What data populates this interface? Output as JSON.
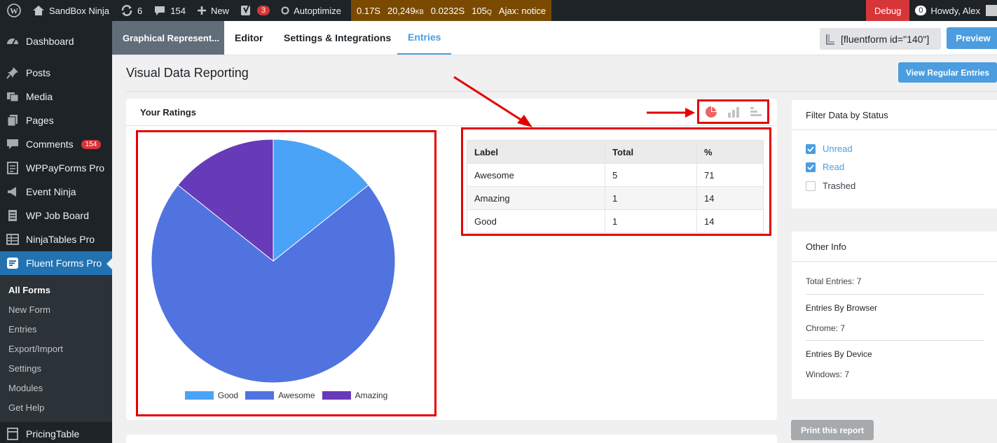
{
  "adminbar": {
    "site_name": "SandBox Ninja",
    "updates_count": "6",
    "comments_count": "154",
    "new_label": "New",
    "yoast_count": "3",
    "autoptimize_label": "Autoptimize",
    "perf_time": "0.17S",
    "perf_memory": "20,249",
    "perf_memory_unit": "KB",
    "perf_query_time": "0.0232S",
    "perf_queries": "105",
    "perf_queries_unit": "Q",
    "perf_ajax": "Ajax: notice",
    "debug_label": "Debug",
    "notif_count": "0",
    "howdy": "Howdy, Alex"
  },
  "sidebar": {
    "items": [
      {
        "label": "Dashboard"
      },
      {
        "label": "Posts"
      },
      {
        "label": "Media"
      },
      {
        "label": "Pages"
      },
      {
        "label": "Comments",
        "badge": "154"
      },
      {
        "label": "WPPayForms Pro"
      },
      {
        "label": "Event Ninja"
      },
      {
        "label": "WP Job Board"
      },
      {
        "label": "NinjaTables Pro"
      },
      {
        "label": "Fluent Forms Pro"
      },
      {
        "label": "PricingTable"
      }
    ],
    "submenu": [
      "All Forms",
      "New Form",
      "Entries",
      "Export/Import",
      "Settings",
      "Modules",
      "Get Help"
    ]
  },
  "topnav": {
    "form_title": "Graphical Represent...",
    "tabs": [
      "Editor",
      "Settings & Integrations",
      "Entries"
    ],
    "shortcode": "[fluentform id=\"140\"]",
    "preview_label": "Preview"
  },
  "page": {
    "title": "Visual Data Reporting",
    "view_regular_label": "View Regular Entries",
    "print_label": "Print this report"
  },
  "report": {
    "card_title": "Your Ratings",
    "table_headers": [
      "Label",
      "Total",
      "%"
    ],
    "rows": [
      [
        "Awesome",
        "5",
        "71"
      ],
      [
        "Amazing",
        "1",
        "14"
      ],
      [
        "Good",
        "1",
        "14"
      ]
    ]
  },
  "chart_data": {
    "type": "pie",
    "categories": [
      "Good",
      "Awesome",
      "Amazing"
    ],
    "values": [
      1,
      5,
      1
    ],
    "colors": [
      "#4aa3f7",
      "#5173e0",
      "#673ab7"
    ],
    "legend": "bottom"
  },
  "filter": {
    "title": "Filter Data by Status",
    "options": [
      {
        "label": "Unread",
        "checked": true
      },
      {
        "label": "Read",
        "checked": true
      },
      {
        "label": "Trashed",
        "checked": false
      }
    ]
  },
  "other_info": {
    "title": "Other Info",
    "total_entries": "Total Entries: 7",
    "browser_heading": "Entries By Browser",
    "browser_value": "Chrome: 7",
    "device_heading": "Entries By Device",
    "device_value": "Windows: 7"
  },
  "colors": {
    "accent": "#4b9de0",
    "highlight": "#e60000",
    "admin_dark": "#1d2327"
  }
}
